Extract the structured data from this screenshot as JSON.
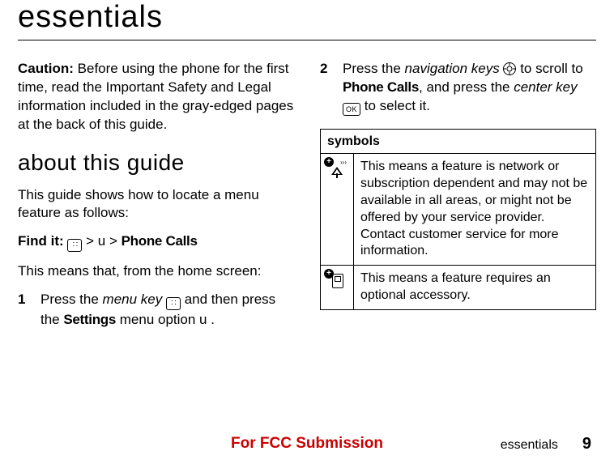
{
  "title": "essentials",
  "caution_label": "Caution:",
  "caution_text": " Before using the phone for the first time, read the Important Safety and Legal information included in the gray-edged pages at the back of this guide.",
  "about_heading": "about this guide",
  "about_intro": "This guide shows how to locate a menu feature as follows:",
  "findit_label": "Find it:",
  "findit_sep1": " > ",
  "findit_u": "u",
  "findit_sep2": "  > ",
  "findit_phone_calls": "Phone Calls",
  "means_intro": "This means that, from the home screen:",
  "step1_num": "1",
  "step1_a": "Press the ",
  "step1_menukey": "menu key",
  "step1_b": " and then press the ",
  "step1_settings": "Settings",
  "step1_c": " menu option ",
  "step1_u": "u",
  "step1_end": " .",
  "step2_num": "2",
  "step2_a": "Press the ",
  "step2_navkeys": "navigation keys",
  "step2_b": " to scroll to ",
  "step2_phone_calls": "Phone Calls",
  "step2_c": ", and press the ",
  "step2_centerkey": "center key",
  "step2_d": " to select it.",
  "symbols_header": "symbols",
  "symbol1_text": "This means a feature is network or subscription dependent and may not be available in all areas, or might not be offered by your service provider. Contact customer service for more information.",
  "symbol2_text": "This means a feature requires an optional accessory.",
  "footer_submission": "For FCC Submission",
  "footer_section": "essentials",
  "footer_page": "9",
  "icons": {
    "menu_key": "menu-key-icon",
    "nav_key": "navigation-key-icon",
    "ok_key": "ok-key-icon",
    "network": "network-dependent-icon",
    "accessory": "accessory-required-icon"
  }
}
